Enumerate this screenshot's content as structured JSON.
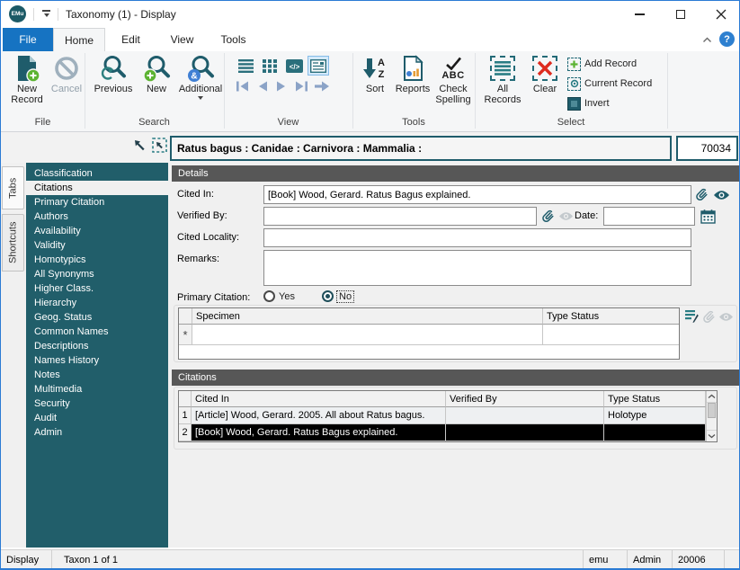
{
  "window": {
    "title": "Taxonomy (1) - Display",
    "logo_text": "EMu"
  },
  "tabs": {
    "file": "File",
    "home": "Home",
    "edit": "Edit",
    "view": "View",
    "tools": "Tools",
    "help_glyph": "?"
  },
  "ribbon": {
    "file": {
      "label": "File",
      "new_record": "New Record",
      "cancel": "Cancel"
    },
    "search": {
      "label": "Search",
      "previous": "Previous",
      "new": "New",
      "additional": "Additional"
    },
    "view": {
      "label": "View"
    },
    "tools": {
      "label": "Tools",
      "sort": "Sort",
      "reports": "Reports",
      "check_spelling": "Check Spelling",
      "abc": "ABC",
      "sort_a": "A",
      "sort_z": "Z",
      "amp": "&",
      "code_glyph": "</>"
    },
    "select": {
      "label": "Select",
      "all_records": "All Records",
      "clear": "Clear",
      "add_record": "Add Record",
      "current_record": "Current Record",
      "invert": "Invert"
    }
  },
  "record_header": {
    "summary": "Ratus bagus : Canidae : Carnivora : Mammalia :",
    "record_number": "70034"
  },
  "sidebar": {
    "tab_strip": [
      "Tabs",
      "Shortcuts"
    ],
    "selected_item": "Citations",
    "items": [
      "Classification",
      "Citations",
      "Primary Citation",
      "Authors",
      "Availability",
      "Validity",
      "Homotypics",
      "All Synonyms",
      "Higher Class.",
      "Hierarchy",
      "Geog. Status",
      "Common Names",
      "Descriptions",
      "Names History",
      "Notes",
      "Multimedia",
      "Security",
      "Audit",
      "Admin"
    ]
  },
  "details": {
    "header": "Details",
    "cited_in_label": "Cited In:",
    "cited_in_value": "[Book] Wood, Gerard. Ratus Bagus explained.",
    "verified_by_label": "Verified By:",
    "verified_by_value": "",
    "date_label": "Date:",
    "date_value": "",
    "cited_locality_label": "Cited Locality:",
    "cited_locality_value": "",
    "remarks_label": "Remarks:",
    "remarks_value": "",
    "primary_citation_label": "Primary Citation:",
    "radio_yes": "Yes",
    "radio_no": "No",
    "primary_citation_selected": "No",
    "specimen_grid": {
      "columns": [
        "Specimen",
        "Type Status"
      ],
      "new_row_marker": "*"
    }
  },
  "citations": {
    "header": "Citations",
    "columns": [
      "Cited In",
      "Verified By",
      "Type Status"
    ],
    "selected_row_index": 1,
    "rows": [
      {
        "num": "1",
        "cited_in": "[Article] Wood, Gerard. 2005. All about Ratus bagus.",
        "verified_by": "",
        "type_status": "Holotype"
      },
      {
        "num": "2",
        "cited_in": "[Book] Wood, Gerard. Ratus Bagus explained.",
        "verified_by": "",
        "type_status": ""
      }
    ]
  },
  "status_bar": {
    "mode": "Display",
    "record_count": "Taxon 1 of 1",
    "server": "emu",
    "user": "Admin",
    "port": "20006"
  },
  "colors": {
    "accent_teal": "#1f5c6b",
    "tab_blue": "#1673c2",
    "green": "#5cb332",
    "red": "#de2b1e",
    "sidebar_teal": "#215e6a",
    "section_gray": "#575757",
    "selection": "#000000"
  }
}
